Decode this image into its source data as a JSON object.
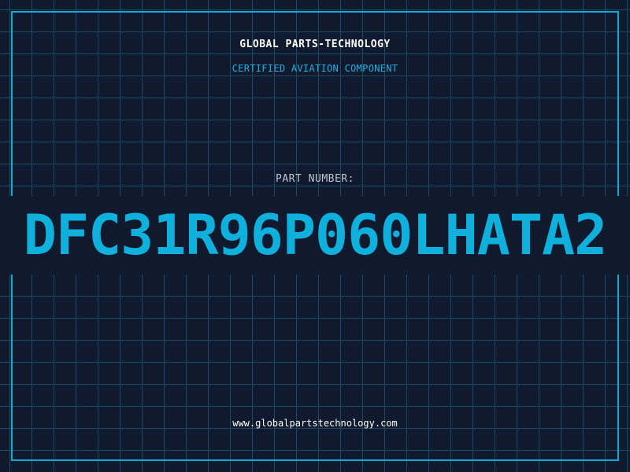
{
  "header": {
    "brand": "GLOBAL PARTS-TECHNOLOGY",
    "subtitle": "CERTIFIED AVIATION COMPONENT"
  },
  "part": {
    "label": "PART NUMBER:",
    "number": "DFC31R96P060LHATA2"
  },
  "footer": {
    "url": "www.globalpartstechnology.com"
  },
  "colors": {
    "background": "#101a2e",
    "grid": "#1d4a5c",
    "accent": "#11a9d6",
    "text_primary": "#ffffff",
    "text_muted": "#bcc5d2"
  }
}
